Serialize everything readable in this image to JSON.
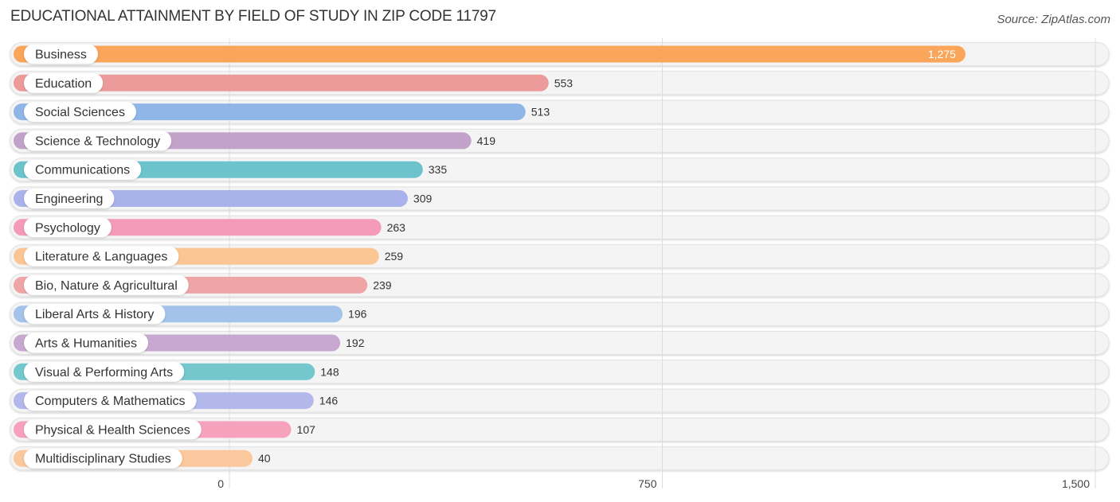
{
  "header": {
    "title": "EDUCATIONAL ATTAINMENT BY FIELD OF STUDY IN ZIP CODE 11797",
    "source": "Source: ZipAtlas.com"
  },
  "chart_data": {
    "type": "bar",
    "orientation": "horizontal",
    "title": "EDUCATIONAL ATTAINMENT BY FIELD OF STUDY IN ZIP CODE 11797",
    "xlabel": "",
    "ylabel": "",
    "xlim": [
      0,
      1500
    ],
    "ticks": [
      0,
      750,
      1500
    ],
    "tick_labels": [
      "0",
      "750",
      "1,500"
    ],
    "grid": true,
    "categories": [
      "Business",
      "Education",
      "Social Sciences",
      "Science & Technology",
      "Communications",
      "Engineering",
      "Psychology",
      "Literature & Languages",
      "Bio, Nature & Agricultural",
      "Liberal Arts & History",
      "Arts & Humanities",
      "Visual & Performing Arts",
      "Computers & Mathematics",
      "Physical & Health Sciences",
      "Multidisciplinary Studies"
    ],
    "values": [
      1275,
      553,
      513,
      419,
      335,
      309,
      263,
      259,
      239,
      196,
      192,
      148,
      146,
      107,
      40
    ],
    "value_labels": [
      "1,275",
      "553",
      "513",
      "419",
      "335",
      "309",
      "263",
      "259",
      "239",
      "196",
      "192",
      "148",
      "146",
      "107",
      "40"
    ],
    "colors": [
      "#f9a55a",
      "#ec9a9a",
      "#8fb6e6",
      "#c3a2c9",
      "#6cc3cc",
      "#a9b2ea",
      "#f59ab8",
      "#fbc594",
      "#efa5a5",
      "#a3c3ea",
      "#c8a8d0",
      "#73c7cd",
      "#b2b8ea",
      "#f6a2bd",
      "#fbc79c"
    ]
  }
}
